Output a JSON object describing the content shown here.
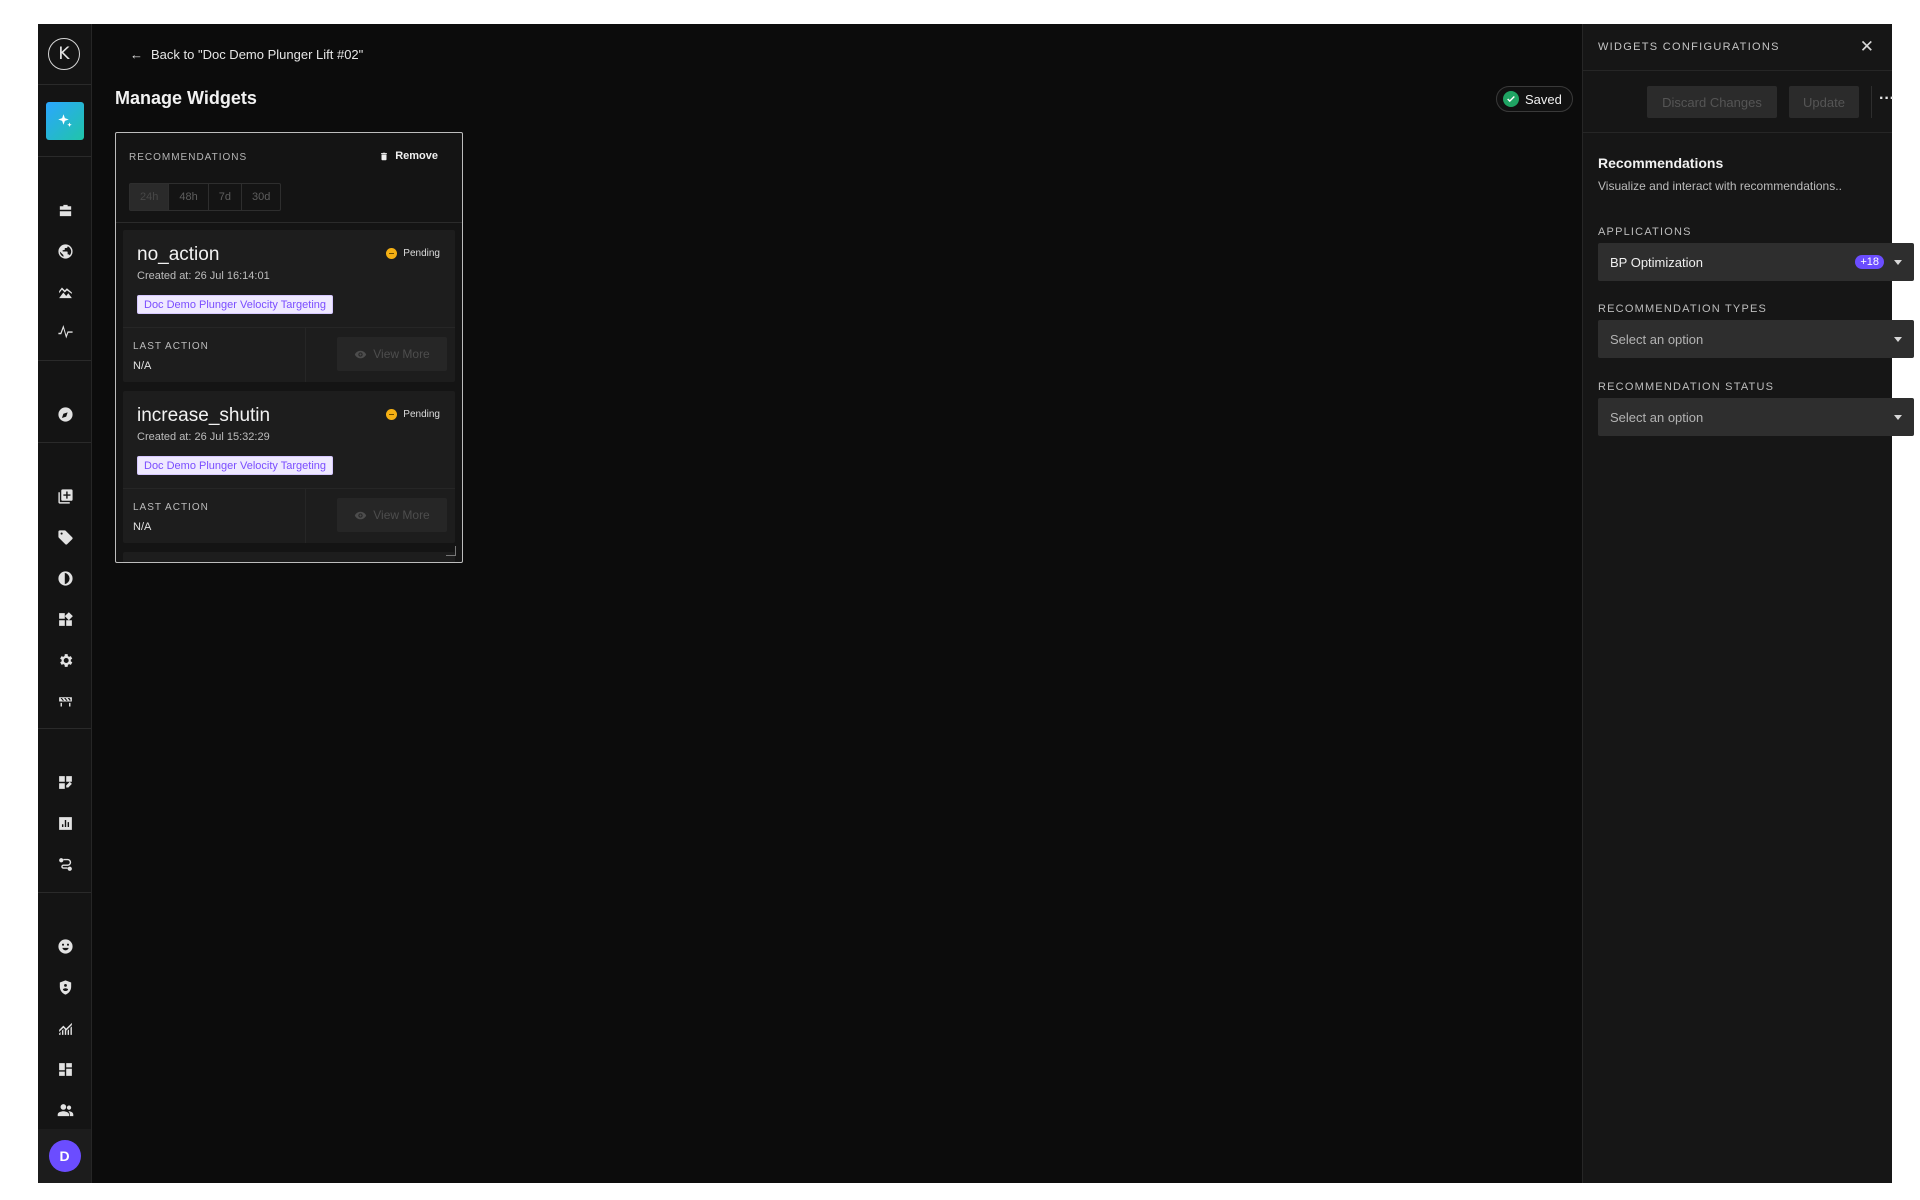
{
  "sidebar": {
    "logo": "K",
    "avatar_initial": "D"
  },
  "header": {
    "back_link": "Back to \"Doc Demo Plunger Lift #02\"",
    "page_title": "Manage Widgets",
    "saved_label": "Saved"
  },
  "widget": {
    "title": "RECOMMENDATIONS",
    "remove_label": "Remove",
    "time_tabs": [
      "24h",
      "48h",
      "7d",
      "30d"
    ],
    "active_tab": "24h",
    "cards": [
      {
        "name": "no_action",
        "status": "Pending",
        "created": "Created at: 26 Jul 16:14:01",
        "tag": "Doc Demo Plunger Velocity Targeting",
        "last_action_label": "LAST ACTION",
        "last_action_value": "N/A",
        "view_more": "View More"
      },
      {
        "name": "increase_shutin",
        "status": "Pending",
        "created": "Created at: 26 Jul 15:32:29",
        "tag": "Doc Demo Plunger Velocity Targeting",
        "last_action_label": "LAST ACTION",
        "last_action_value": "N/A",
        "view_more": "View More"
      }
    ]
  },
  "panel": {
    "title": "WIDGETS CONFIGURATIONS",
    "discard_label": "Discard Changes",
    "update_label": "Update",
    "section_title": "Recommendations",
    "section_desc": "Visualize and interact with recommendations..",
    "applications_label": "APPLICATIONS",
    "applications_value": "BP Optimization",
    "applications_badge": "+18",
    "types_label": "RECOMMENDATION TYPES",
    "types_placeholder": "Select an option",
    "status_label": "RECOMMENDATION STATUS",
    "status_placeholder": "Select an option"
  },
  "colors": {
    "background": "#0c0c0c",
    "accent": "#6b4dff",
    "success": "#1fa463",
    "pending": "#f5b014",
    "tag_text": "#7a4dff"
  }
}
